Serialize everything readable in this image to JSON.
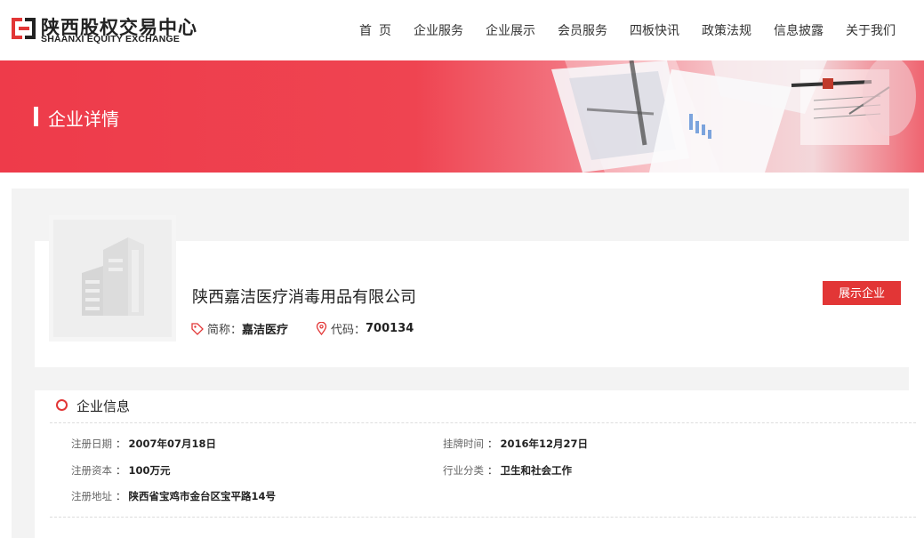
{
  "header": {
    "logo_cn": "陕西股权交易中心",
    "logo_en": "SHAANXI EQUITY EXCHANGE",
    "nav": [
      "首页",
      "企业服务",
      "企业展示",
      "会员服务",
      "四板快讯",
      "政策法规",
      "信息披露",
      "关于我们"
    ]
  },
  "banner": {
    "title": "企业详情"
  },
  "company": {
    "name": "陕西嘉洁医疗消毒用品有限公司",
    "short_label": "简称：",
    "short_value": "嘉洁医疗",
    "code_label": "代码：",
    "code_value": "700134",
    "show_button": "展示企业"
  },
  "info": {
    "title": "企业信息",
    "fields": [
      {
        "label": "注册日期",
        "value": "2007年07月18日"
      },
      {
        "label": "挂牌时间",
        "value": "2016年12月27日"
      },
      {
        "label": "注册资本",
        "value": "100万元"
      },
      {
        "label": "行业分类",
        "value": "卫生和社会工作"
      },
      {
        "label": "注册地址",
        "value": "陕西省宝鸡市金台区宝平路14号"
      }
    ],
    "separator": "："
  },
  "colors": {
    "accent": "#e23636",
    "banner": "#ee3b4a"
  }
}
